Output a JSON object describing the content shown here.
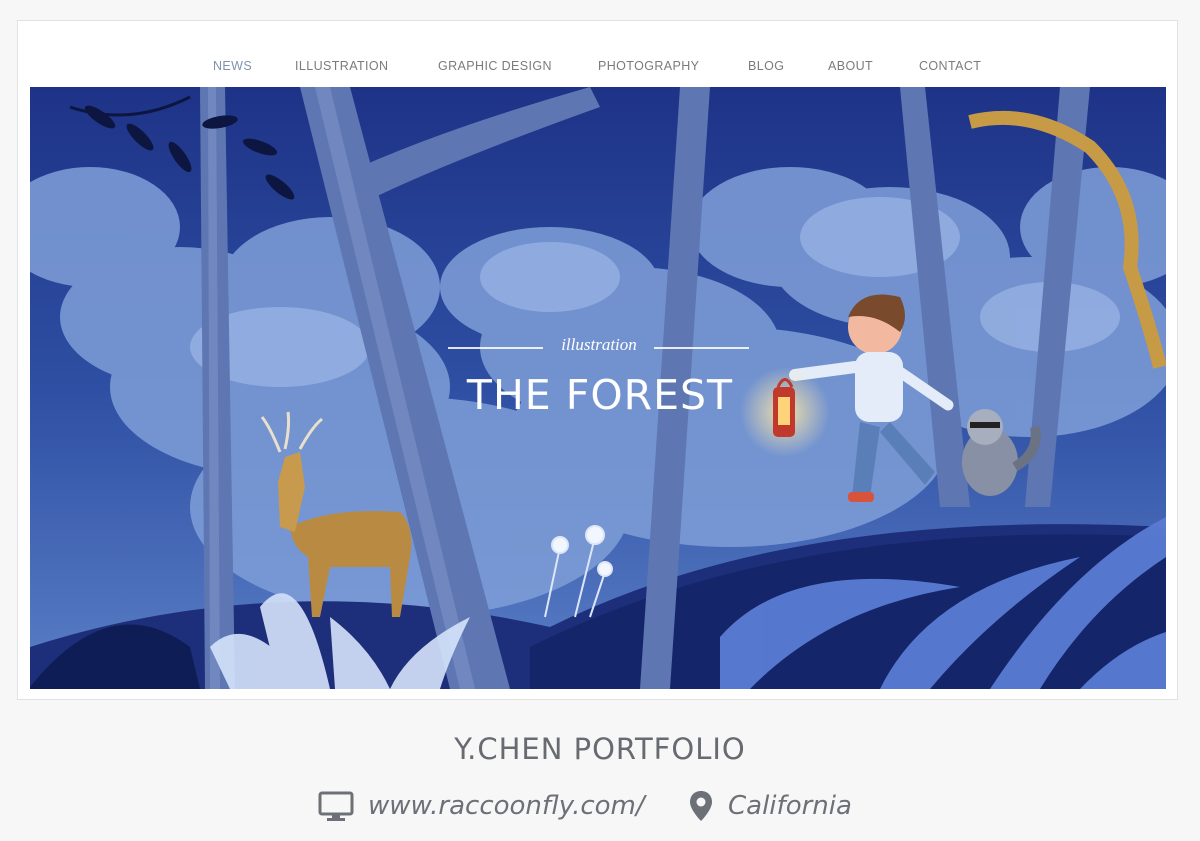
{
  "nav": {
    "items": [
      {
        "label": "NEWS",
        "active": true
      },
      {
        "label": "ILLUSTRATION",
        "active": false
      },
      {
        "label": "GRAPHIC DESIGN",
        "active": false
      },
      {
        "label": "PHOTOGRAPHY",
        "active": false
      },
      {
        "label": "BLOG",
        "active": false
      },
      {
        "label": "ABOUT",
        "active": false
      },
      {
        "label": "CONTACT",
        "active": false
      }
    ]
  },
  "hero": {
    "subtitle": "illustration",
    "title": "THE FOREST"
  },
  "portfolio": {
    "title": "Y.CHEN PORTFOLIO",
    "website": "www.raccoonfly.com/",
    "location": "California",
    "website_icon": "monitor-icon",
    "location_icon": "map-pin-icon"
  },
  "colors": {
    "nav_active": "#7f93ad",
    "nav_text": "#7b7b7b",
    "meta_text": "#6d7077",
    "sky_deep": "#243d8f",
    "cloud": "#8fb0e3"
  }
}
